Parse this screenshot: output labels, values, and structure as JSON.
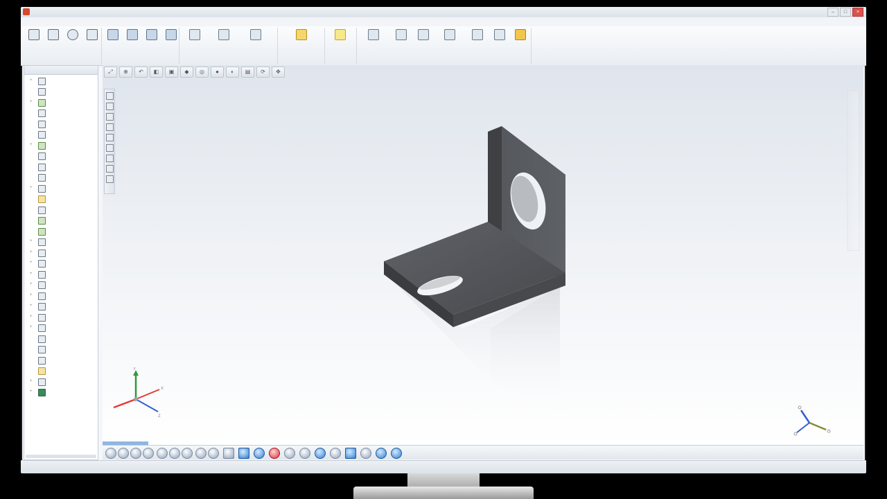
{
  "window": {
    "title": "",
    "controls": {
      "minimize": "–",
      "maximize": "□",
      "close": "×"
    }
  },
  "menubar": {
    "items": [
      "",
      "",
      "",
      "",
      "",
      "",
      "",
      ""
    ]
  },
  "ribbon": {
    "groups": []
  },
  "tree": {
    "header": "",
    "items": []
  },
  "viewport": {
    "heads_up_icons": [
      "zoom-fit-icon",
      "zoom-area-icon",
      "previous-view-icon",
      "section-view-icon",
      "view-orientation-icon",
      "display-style-icon",
      "hide-show-icon",
      "edit-appearance-icon",
      "scene-icon",
      "view-settings-icon",
      "rotate-icon",
      "pan-icon"
    ],
    "model_color": "#55585d",
    "background_top": "#dfe5ec",
    "background_bottom": "#ffffff"
  },
  "status": {
    "left": "",
    "right": ""
  },
  "colors": {
    "accent": "#2f7fd3",
    "close": "#d9534f",
    "axis_x": "#e53935",
    "axis_y": "#2e9a3a",
    "axis_z": "#2f5fd3"
  }
}
